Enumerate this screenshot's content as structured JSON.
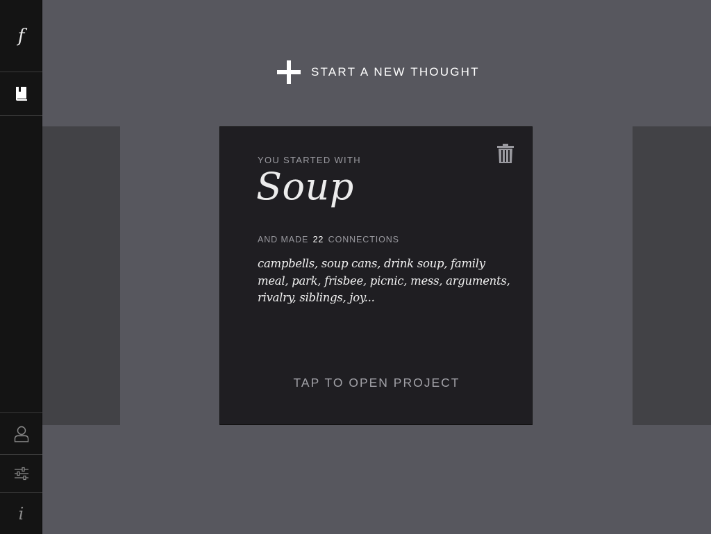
{
  "sidebar": {
    "logo": "f",
    "info": "i",
    "items": [
      {
        "name": "projects",
        "icon": "book-icon"
      },
      {
        "name": "account",
        "icon": "user-icon"
      },
      {
        "name": "settings",
        "icon": "sliders-icon"
      },
      {
        "name": "info",
        "icon": "info-icon"
      }
    ]
  },
  "header": {
    "new_thought_label": "START A NEW THOUGHT",
    "icon": "plus-icon"
  },
  "card": {
    "started_label": "YOU STARTED WITH",
    "title": "Soup",
    "made_prefix": "AND MADE",
    "connection_count": "22",
    "made_suffix": "CONNECTIONS",
    "connections_text": "campbells, soup cans, drink soup, family meal, park, frisbee, picnic, mess, arguments, rivalry, siblings, joy...",
    "open_label": "TAP TO OPEN PROJECT",
    "delete_icon": "trash-icon"
  },
  "colors": {
    "background": "#57575e",
    "sidebar": "#141414",
    "card": "#1f1e22",
    "side_card": "#424246",
    "accent_text": "#ffffff",
    "muted_text": "#9a9aa0"
  }
}
